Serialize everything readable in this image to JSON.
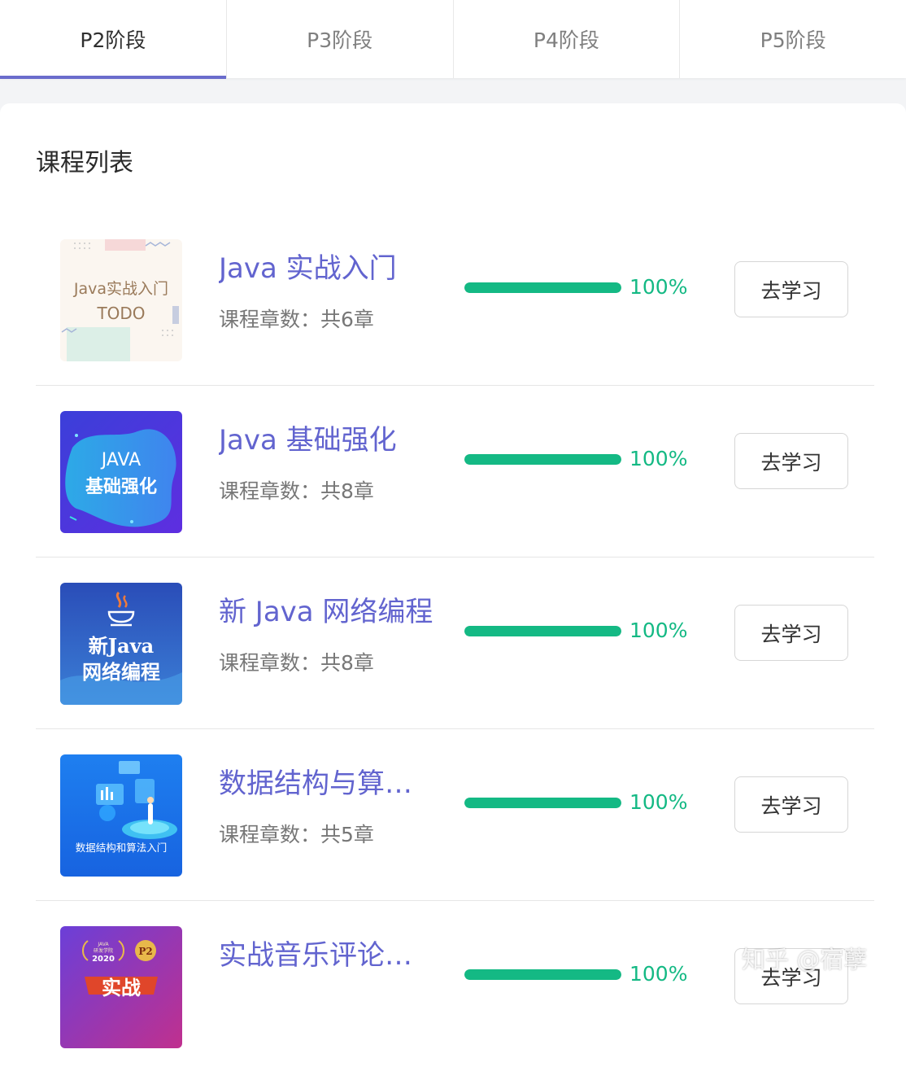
{
  "tabs": [
    {
      "label": "P2阶段",
      "active": true
    },
    {
      "label": "P3阶段",
      "active": false
    },
    {
      "label": "P4阶段",
      "active": false
    },
    {
      "label": "P5阶段",
      "active": false
    }
  ],
  "section_title": "课程列表",
  "courses": [
    {
      "title": "Java 实战入门",
      "chapters": "课程章数：共6章",
      "progress": 100,
      "progress_text": "100%",
      "button": "去学习",
      "thumb": {
        "line1": "Java实战入门",
        "line2": "TODO"
      }
    },
    {
      "title": "Java 基础强化",
      "chapters": "课程章数：共8章",
      "progress": 100,
      "progress_text": "100%",
      "button": "去学习",
      "thumb": {
        "line1": "JAVA",
        "line2": "基础强化"
      }
    },
    {
      "title": "新 Java 网络编程",
      "chapters": "课程章数：共8章",
      "progress": 100,
      "progress_text": "100%",
      "button": "去学习",
      "thumb": {
        "line1": "新Java",
        "line2": "网络编程"
      }
    },
    {
      "title": "数据结构与算法…",
      "chapters": "课程章数：共5章",
      "progress": 100,
      "progress_text": "100%",
      "button": "去学习",
      "thumb": {
        "line1": "数据结构和算法入门"
      }
    },
    {
      "title": "实战音乐评论分析",
      "chapters": "",
      "progress": 100,
      "progress_text": "100%",
      "button": "去学习",
      "thumb": {
        "line1": "JAVA",
        "line2": "研发学院",
        "line3": "2020",
        "badge": "P2",
        "line4": "实战"
      }
    }
  ],
  "watermark": "知乎 @宿孽",
  "colors": {
    "accent": "#6264cf",
    "progress": "#14b984",
    "tab_indicator": "#6a6ccc"
  }
}
